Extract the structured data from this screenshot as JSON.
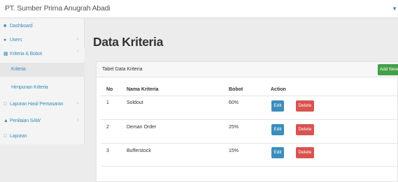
{
  "header": {
    "brand": "PT. Sumber Prima Anugrah Abadi"
  },
  "sidebar": {
    "items": [
      {
        "label": "Dashboard",
        "icon": "dashboard-icon"
      },
      {
        "label": "Users",
        "icon": "user-icon"
      },
      {
        "label": "Kriteria & Bobot",
        "icon": "table-icon"
      },
      {
        "label": "Kriteria"
      },
      {
        "label": "Himpunan Kriteria"
      },
      {
        "label": "Laporan Hasil Pemasaran",
        "icon": "document-icon"
      },
      {
        "label": "Penilaian SAW",
        "icon": "sitemap-icon"
      },
      {
        "label": "Laporan",
        "icon": "document-icon"
      }
    ]
  },
  "page": {
    "title": "Data Kriteria"
  },
  "panel": {
    "title": "Tabel Data Kriteria",
    "add_label": "Add New"
  },
  "table": {
    "headers": [
      "No",
      "Nama Kriteria",
      "Bobot",
      "Action"
    ],
    "rows": [
      {
        "no": "1",
        "nama": "Soldout",
        "bobot": "60%"
      },
      {
        "no": "2",
        "nama": "Deman Order",
        "bobot": "25%"
      },
      {
        "no": "3",
        "nama": "Bufferstock",
        "bobot": "15%"
      }
    ],
    "edit_label": "Edit",
    "delete_label": "Delete"
  },
  "colors": {
    "accent": "#3c8dbc",
    "add_button": "#43a047",
    "delete_button": "#d9534f"
  }
}
